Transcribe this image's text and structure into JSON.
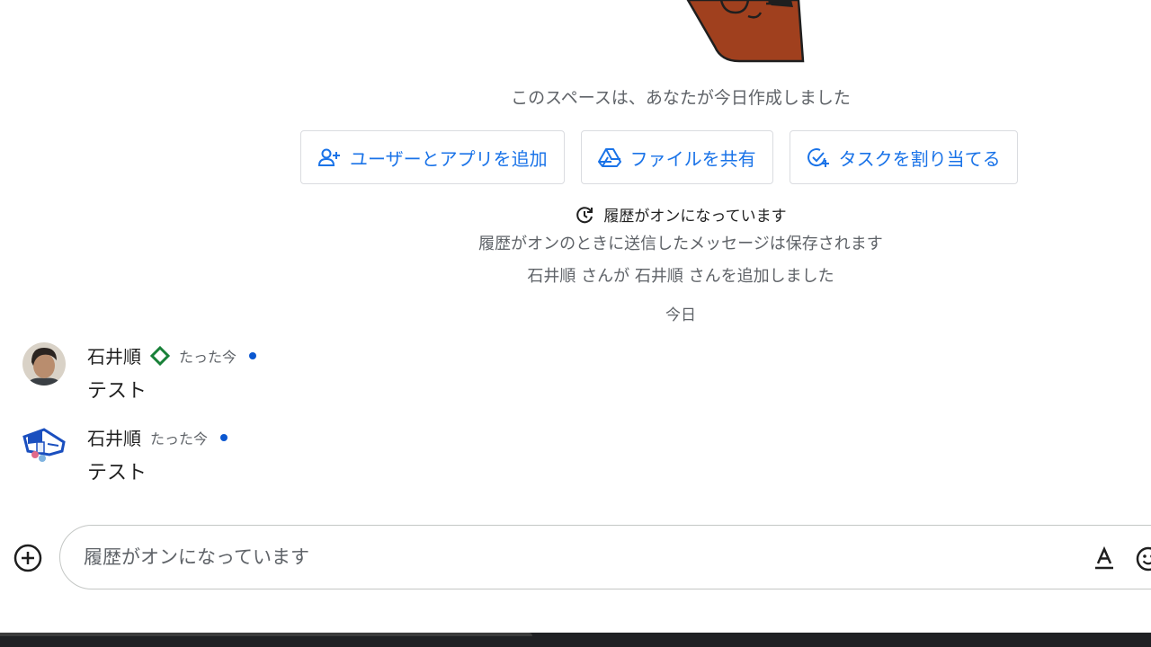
{
  "space": {
    "created_text": "このスペースは、あなたが今日作成しました"
  },
  "actions": [
    {
      "label": "ユーザーとアプリを追加",
      "icon": "person-add-icon"
    },
    {
      "label": "ファイルを共有",
      "icon": "drive-icon"
    },
    {
      "label": "タスクを割り当てる",
      "icon": "add-task-icon"
    }
  ],
  "history": {
    "status": "履歴がオンになっています",
    "note": "履歴がオンのときに送信したメッセージは保存されます"
  },
  "system_message": "石井順 さんが 石井順 さんを追加しました",
  "date_divider": "今日",
  "messages": [
    {
      "sender": "石井順",
      "time": "たった今",
      "text": "テスト",
      "badge": "diamond-icon"
    },
    {
      "sender": "石井順",
      "time": "たった今",
      "text": "テスト"
    }
  ],
  "composer": {
    "placeholder": "履歴がオンになっています",
    "value": ""
  },
  "colors": {
    "accent": "#1a73e8",
    "unread": "#0b57d0",
    "badge": "#188038",
    "illustration_skin": "#a0401e"
  }
}
